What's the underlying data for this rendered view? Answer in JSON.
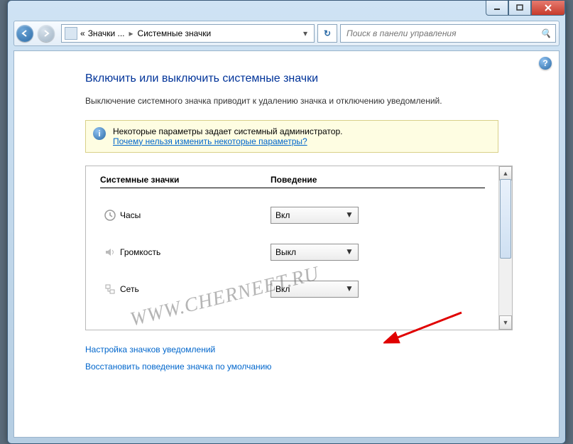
{
  "breadcrumb": {
    "root": "«",
    "p1": "Значки ...",
    "p2": "Системные значки"
  },
  "search": {
    "placeholder": "Поиск в панели управления"
  },
  "heading": "Включить или выключить системные значки",
  "description": "Выключение системного значка приводит к удалению значка и отключению уведомлений.",
  "info": {
    "line1": "Некоторые параметры задает системный администратор.",
    "link": "Почему нельзя изменить некоторые параметры?"
  },
  "columns": {
    "c1": "Системные значки",
    "c2": "Поведение"
  },
  "items": [
    {
      "name": "Часы",
      "value": "Вкл"
    },
    {
      "name": "Громкость",
      "value": "Выкл"
    },
    {
      "name": "Сеть",
      "value": "Вкл"
    }
  ],
  "links": {
    "l1": "Настройка значков уведомлений",
    "l2": "Восстановить поведение значка по умолчанию"
  },
  "watermark": "WWW.CHERNEET.RU"
}
